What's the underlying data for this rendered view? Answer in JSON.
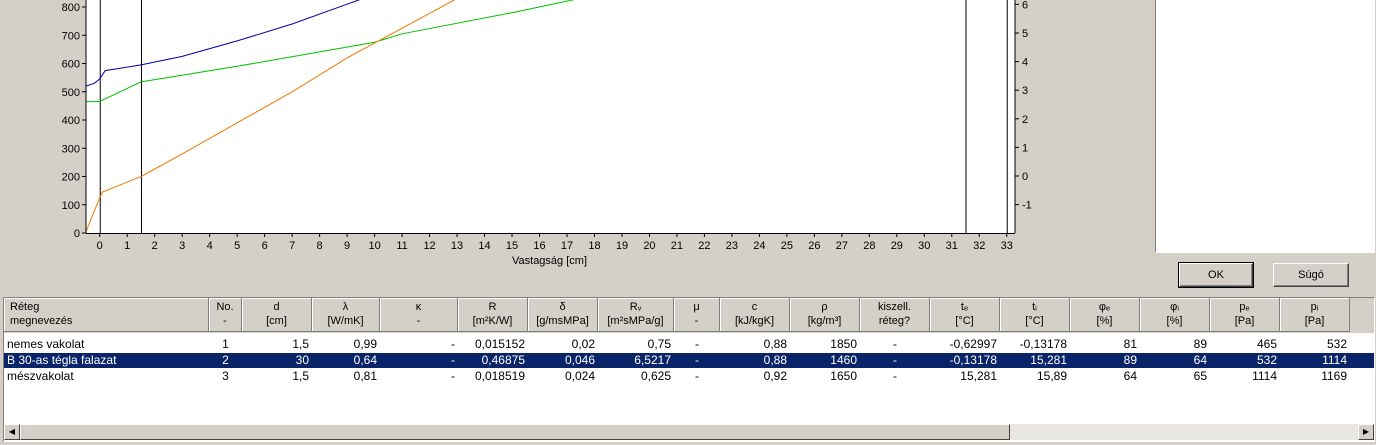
{
  "chart_data": {
    "type": "line",
    "xlabel": "Vastagság [cm]",
    "x_ticks": [
      "0",
      "1",
      "2",
      "3",
      "4",
      "5",
      "6",
      "7",
      "8",
      "9",
      "10",
      "11",
      "12",
      "13",
      "14",
      "15",
      "16",
      "17",
      "18",
      "19",
      "20",
      "21",
      "22",
      "23",
      "24",
      "25",
      "26",
      "27",
      "28",
      "29",
      "30",
      "31",
      "32",
      "33"
    ],
    "left_ticks": [
      "0",
      "100",
      "200",
      "300",
      "400",
      "500",
      "600",
      "700",
      "800"
    ],
    "right_ticks": [
      "-1",
      "0",
      "1",
      "2",
      "3",
      "4",
      "5",
      "6"
    ],
    "layer_boundaries_cm": [
      0,
      1.5,
      31.5,
      33
    ],
    "xlim": [
      -0.5,
      33.3
    ],
    "ylim_left": [
      0,
      850
    ],
    "series": [
      {
        "color": "#0000a0",
        "x": [
          -0.5,
          -0.2,
          0,
          0.2,
          1.5,
          3,
          5,
          7,
          9,
          11,
          11.5
        ],
        "y": [
          520,
          530,
          545,
          575,
          595,
          625,
          680,
          740,
          810,
          880,
          895
        ]
      },
      {
        "color": "#00c000",
        "x": [
          -0.5,
          0,
          0.2,
          1.5,
          5,
          10,
          11,
          15,
          19
        ],
        "y": [
          465,
          465,
          475,
          535,
          590,
          675,
          705,
          780,
          862
        ]
      },
      {
        "color": "#f07800",
        "x": [
          -0.5,
          0,
          0.1,
          1.5,
          3,
          5,
          7,
          9,
          11,
          13,
          14.2
        ],
        "y": [
          5,
          125,
          145,
          200,
          280,
          390,
          500,
          620,
          725,
          830,
          880
        ]
      }
    ]
  },
  "buttons": {
    "ok": "OK",
    "help": "Súgó"
  },
  "table": {
    "headers": [
      {
        "l1": "Réteg",
        "l2": "megnevezés"
      },
      {
        "l1": "No.",
        "l2": "-"
      },
      {
        "l1": "d",
        "l2": "[cm]"
      },
      {
        "l1": "λ",
        "l2": "[W/mK]"
      },
      {
        "l1": "κ",
        "l2": "-"
      },
      {
        "l1": "R",
        "l2": "[m²K/W]"
      },
      {
        "l1": "δ",
        "l2": "[g/msMPa]"
      },
      {
        "l1": "Rᵥ",
        "l2": "[m²sMPa/g]"
      },
      {
        "l1": "μ",
        "l2": "-"
      },
      {
        "l1": "c",
        "l2": "[kJ/kgK]"
      },
      {
        "l1": "ρ",
        "l2": "[kg/m³]"
      },
      {
        "l1": "kiszell.",
        "l2": "réteg?"
      },
      {
        "l1": "tₑ",
        "l2": "[°C]"
      },
      {
        "l1": "tᵢ",
        "l2": "[°C]"
      },
      {
        "l1": "φₑ",
        "l2": "[%]"
      },
      {
        "l1": "φᵢ",
        "l2": "[%]"
      },
      {
        "l1": "pₑ",
        "l2": "[Pa]"
      },
      {
        "l1": "pᵢ",
        "l2": "[Pa]"
      }
    ],
    "rows": [
      [
        "nemes vakolat",
        "1",
        "1,5",
        "0,99",
        "-",
        "0,015152",
        "0,02",
        "0,75",
        "-",
        "0,88",
        "1850",
        "-",
        "-0,62997",
        "-0,13178",
        "81",
        "89",
        "465",
        "532"
      ],
      [
        "B 30-as tégla falazat",
        "2",
        "30",
        "0,64",
        "-",
        "0,46875",
        "0,046",
        "6,5217",
        "-",
        "0,88",
        "1460",
        "-",
        "-0,13178",
        "15,281",
        "89",
        "64",
        "532",
        "1114"
      ],
      [
        "mészvakolat",
        "3",
        "1,5",
        "0,81",
        "-",
        "0,018519",
        "0,024",
        "0,625",
        "-",
        "0,92",
        "1650",
        "-",
        "15,281",
        "15,89",
        "64",
        "65",
        "1114",
        "1169"
      ]
    ],
    "selected_row": 1
  }
}
